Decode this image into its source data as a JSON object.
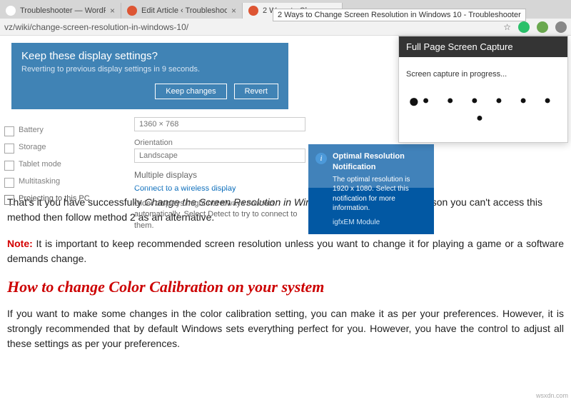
{
  "browser": {
    "tabs": [
      {
        "title": "Troubleshooter — WordP"
      },
      {
        "title": "Edit Article ‹ Troubleshooter — W"
      },
      {
        "title": "2 Ways to Ch"
      }
    ],
    "tooltip": "2 Ways to Change Screen Resolution in Windows 10 - Troubleshooter",
    "url": "vz/wiki/change-screen-resolution-in-windows-10/",
    "star": "☆"
  },
  "settings_dialog": {
    "question": "Keep these display settings?",
    "sub": "Reverting to previous display settings in  9 seconds.",
    "keep": "Keep changes",
    "revert": "Revert"
  },
  "sidebar": {
    "items": [
      {
        "label": "Battery"
      },
      {
        "label": "Storage"
      },
      {
        "label": "Tablet mode"
      },
      {
        "label": "Multitasking"
      },
      {
        "label": "Projecting to this PC"
      }
    ]
  },
  "panel": {
    "resolution": "1360 × 768",
    "orientation_label": "Orientation",
    "orientation": "Landscape",
    "multi_header": "Multiple displays",
    "connect": "Connect to a wireless display",
    "hint": "Older displays might not always connect automatically. Select Detect to try to connect to them."
  },
  "card": {
    "title": "Optimal Resolution Notification",
    "body": "The optimal resolution is 1920 x 1080. Select this notification for more information.",
    "mod": "igfxEM Module"
  },
  "popup": {
    "title": "Full Page Screen Capture",
    "status": "Screen capture in progress..."
  },
  "article": {
    "p1a": "That's it you have successfully ",
    "p1em": "Change the Screen Resolution in Windows 10",
    "p1b": " but if for some reason you can't access this method then follow method 2 as an alternative.",
    "note_label": "Note:",
    "note_body": " It is important to keep recommended screen resolution unless you want to change it for playing a game or a software demands change.",
    "h2": "How to change Color Calibration on your system",
    "p3": "If you want to make some changes in the color calibration setting, you can make it as per your preferences. However, it is strongly recommended that by default Windows sets everything perfect for you. However, you have the control to adjust all these settings as per your preferences."
  },
  "watermark": "wsxdn.com"
}
